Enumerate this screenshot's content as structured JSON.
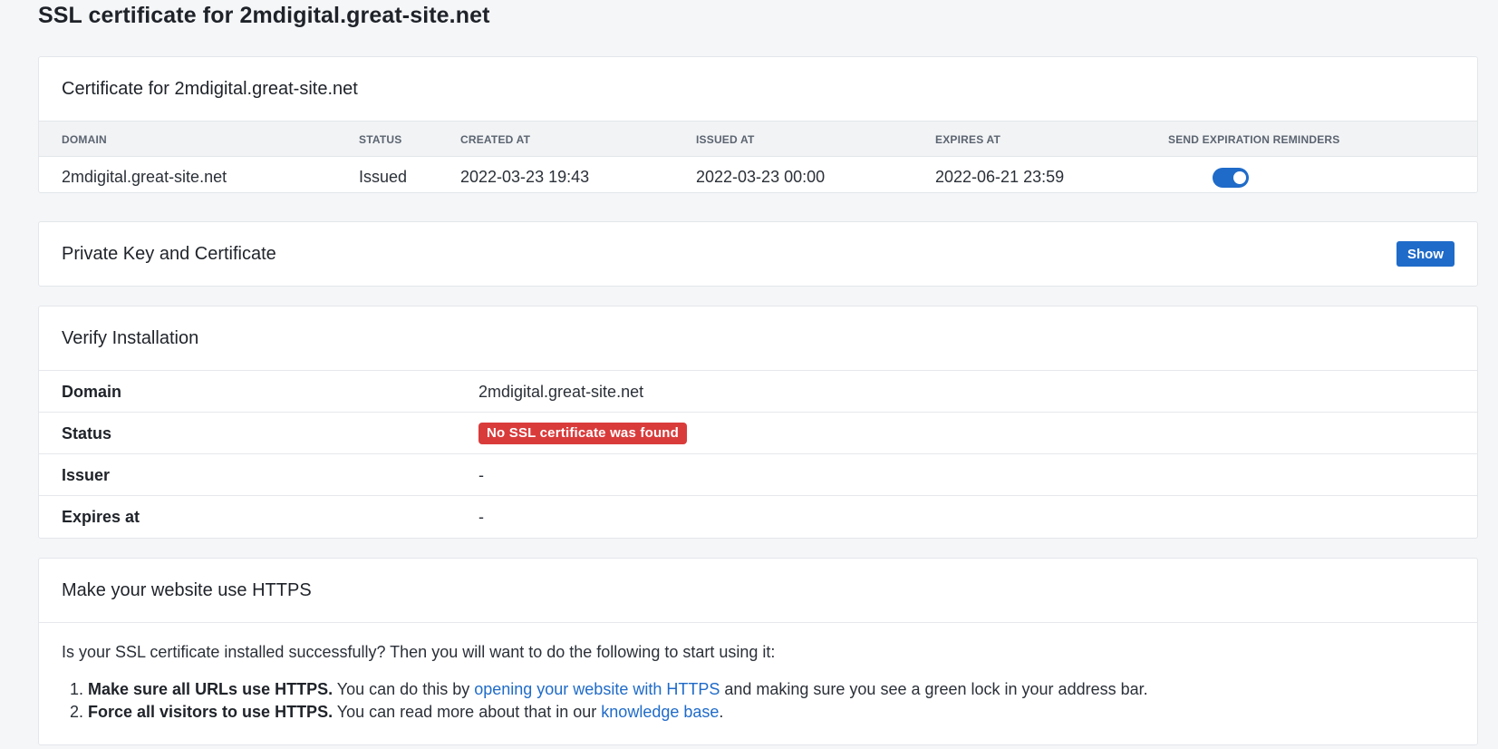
{
  "page": {
    "title": "SSL certificate for 2mdigital.great-site.net"
  },
  "certificate": {
    "card_title": "Certificate for 2mdigital.great-site.net",
    "columns": {
      "domain": "DOMAIN",
      "status": "STATUS",
      "created_at": "CREATED AT",
      "issued_at": "ISSUED AT",
      "expires_at": "EXPIRES AT",
      "send_reminders": "SEND EXPIRATION REMINDERS"
    },
    "row": {
      "domain": "2mdigital.great-site.net",
      "status": "Issued",
      "created_at": "2022-03-23 19:43",
      "issued_at": "2022-03-23 00:00",
      "expires_at": "2022-06-21 23:59",
      "reminders_enabled": true
    }
  },
  "private_key": {
    "card_title": "Private Key and Certificate",
    "show_label": "Show"
  },
  "verify": {
    "card_title": "Verify Installation",
    "rows": {
      "domain": {
        "label": "Domain",
        "value": "2mdigital.great-site.net"
      },
      "status": {
        "label": "Status",
        "badge": "No SSL certificate was found",
        "badge_color": "#d93b3b"
      },
      "issuer": {
        "label": "Issuer",
        "value": "-"
      },
      "expires": {
        "label": "Expires at",
        "value": "-"
      }
    }
  },
  "https": {
    "card_title": "Make your website use HTTPS",
    "intro": "Is your SSL certificate installed successfully? Then you will want to do the following to start using it:",
    "steps": [
      {
        "bold": "Make sure all URLs use HTTPS.",
        "text_before": " You can do this by ",
        "link": "opening your website with HTTPS",
        "text_after": " and making sure you see a green lock in your address bar."
      },
      {
        "bold": "Force all visitors to use HTTPS.",
        "text_before": " You can read more about that in our ",
        "link": "knowledge base",
        "text_after": "."
      }
    ]
  },
  "colors": {
    "accent": "#1f6bc9",
    "danger": "#d93b3b",
    "background": "#f5f6f8"
  }
}
